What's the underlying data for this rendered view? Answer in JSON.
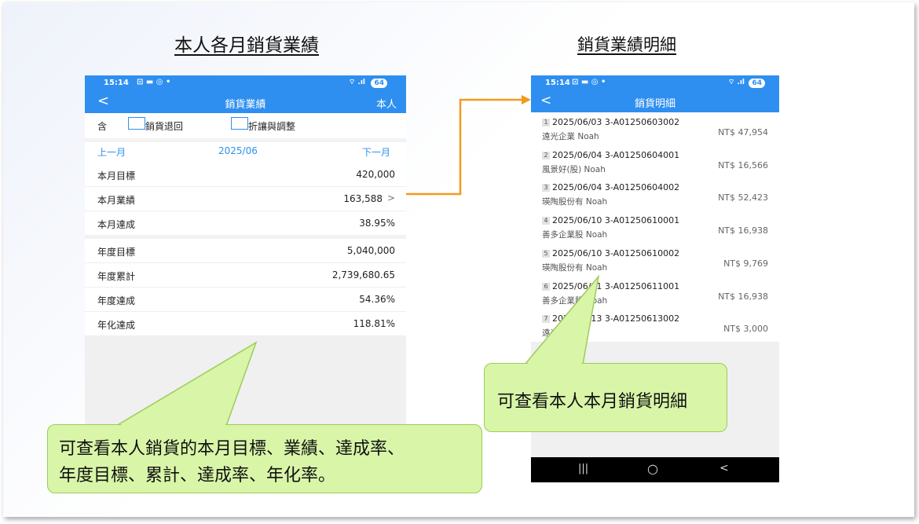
{
  "headings": {
    "left": "本人各月銷貨業績",
    "right": "銷貨業績明細"
  },
  "left_phone": {
    "status_time": "15:14",
    "battery": "64",
    "app_title": "銷貨業績",
    "right_action": "本人",
    "filters": {
      "include_label": "含",
      "returns_label": "銷貨退回",
      "discount_label": "折讓與調整"
    },
    "month_nav": {
      "prev": "上一月",
      "current": "2025/06",
      "next": "下一月"
    },
    "monthly": [
      {
        "label": "本月目標",
        "value": "420,000"
      },
      {
        "label": "本月業績",
        "value": "163,588",
        "chevron": ">"
      },
      {
        "label": "本月達成",
        "value": "38.95%"
      }
    ],
    "yearly": [
      {
        "label": "年度目標",
        "value": "5,040,000"
      },
      {
        "label": "年度累計",
        "value": "2,739,680.65"
      },
      {
        "label": "年度達成",
        "value": "54.36%"
      },
      {
        "label": "年化達成",
        "value": "118.81%"
      }
    ]
  },
  "right_phone": {
    "status_time": "15:14",
    "battery": "64",
    "app_title": "銷貨明細",
    "items": [
      {
        "num": "1",
        "date": "2025/06/03",
        "doc": "3-A01250603002",
        "customer": "遠光企業 Noah",
        "amount": "NT$ 47,954"
      },
      {
        "num": "2",
        "date": "2025/06/04",
        "doc": "3-A01250604001",
        "customer": "風景好(股) Noah",
        "amount": "NT$ 16,566"
      },
      {
        "num": "3",
        "date": "2025/06/04",
        "doc": "3-A01250604002",
        "customer": "瑛陶股份有 Noah",
        "amount": "NT$ 52,423"
      },
      {
        "num": "4",
        "date": "2025/06/10",
        "doc": "3-A01250610001",
        "customer": "善多企業股 Noah",
        "amount": "NT$ 16,938"
      },
      {
        "num": "5",
        "date": "2025/06/10",
        "doc": "3-A01250610002",
        "customer": "瑛陶股份有 Noah",
        "amount": "NT$ 9,769"
      },
      {
        "num": "6",
        "date": "2025/06/11",
        "doc": "3-A01250611001",
        "customer": "善多企業股 Noah",
        "amount": "NT$ 16,938"
      },
      {
        "num": "7",
        "date": "2025/06/13",
        "doc": "3-A01250613002",
        "customer": "遠光 Noah",
        "amount": "NT$ 3,000"
      }
    ],
    "nav": {
      "recent": "|||",
      "home": "○",
      "back": "<"
    }
  },
  "callouts": {
    "left_line1": "可查看本人銷貨的本月目標、業績、達成率、",
    "left_line2": "年度目標、累計、達成率、年化率。",
    "right": "可查看本人本月銷貨明細"
  },
  "colors": {
    "app_blue": "#2f8ff0",
    "arrow_orange": "#f39a1e",
    "callout_green": "#d8f5a8"
  }
}
